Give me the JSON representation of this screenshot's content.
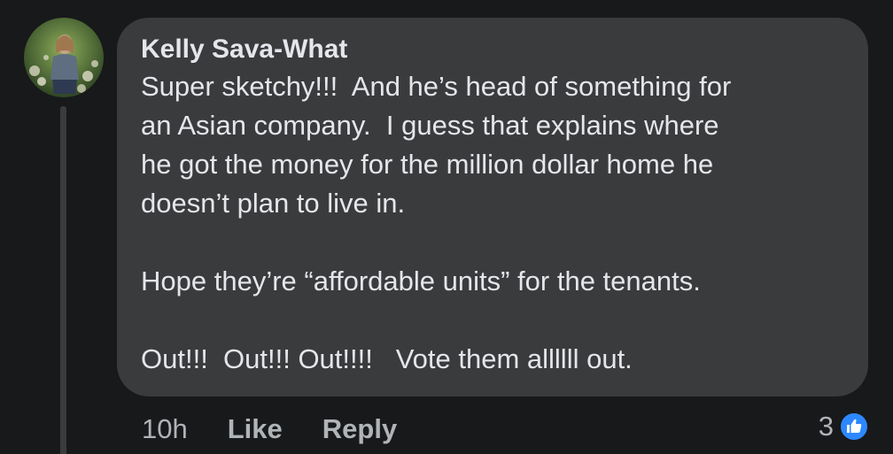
{
  "comment": {
    "author": "Kelly Sava-What",
    "lines": [
      "Super sketchy!!!  And he’s head of something for",
      "an Asian company.  I guess that explains where",
      "he got the money for the million dollar home he",
      "doesn’t plan to live in.",
      "",
      "Hope they’re “affordable units” for the tenants.",
      "",
      "Out!!!  Out!!! Out!!!!   Vote them allllll out."
    ],
    "timestamp": "10h",
    "like_label": "Like",
    "reply_label": "Reply",
    "reaction_count": "3",
    "reaction_icon": "thumbs-up-icon"
  },
  "colors": {
    "background": "#18191a",
    "bubble": "#3a3b3c",
    "text_primary": "#e4e6eb",
    "text_secondary": "#b0b3b8",
    "like_blue": "#2d88ff"
  }
}
